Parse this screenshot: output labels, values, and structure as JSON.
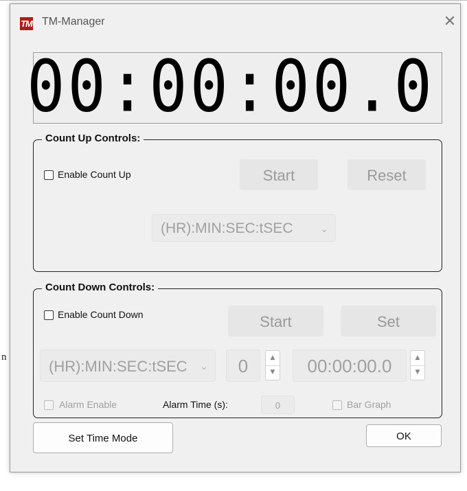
{
  "background": {
    "left_char": "n"
  },
  "window": {
    "title": "TM-Manager",
    "icon_text": "TM",
    "close_glyph": "✕",
    "brand_color": "#b11b1b"
  },
  "display": {
    "time": "00:00:00.0"
  },
  "count_up": {
    "title": "Count Up Controls:",
    "enable_label": "Enable Count Up",
    "start_label": "Start",
    "reset_label": "Reset",
    "format_value": "(HR):MIN:SEC:tSEC"
  },
  "count_down": {
    "title": "Count Down Controls:",
    "enable_label": "Enable Count Down",
    "start_label": "Start",
    "set_label": "Set",
    "format_value": "(HR):MIN:SEC:tSEC",
    "number_value": "0",
    "time_value": "00:00:00.0",
    "alarm_enable_label": "Alarm Enable",
    "alarm_time_label": "Alarm Time (s):",
    "alarm_time_value": "0",
    "bar_graph_label": "Bar Graph"
  },
  "footer": {
    "set_time_mode_label": "Set Time Mode",
    "ok_label": "OK"
  },
  "icons": {
    "chevron": "chevron-down-icon",
    "spin_up": "spin-up-icon",
    "spin_down": "spin-down-icon"
  }
}
